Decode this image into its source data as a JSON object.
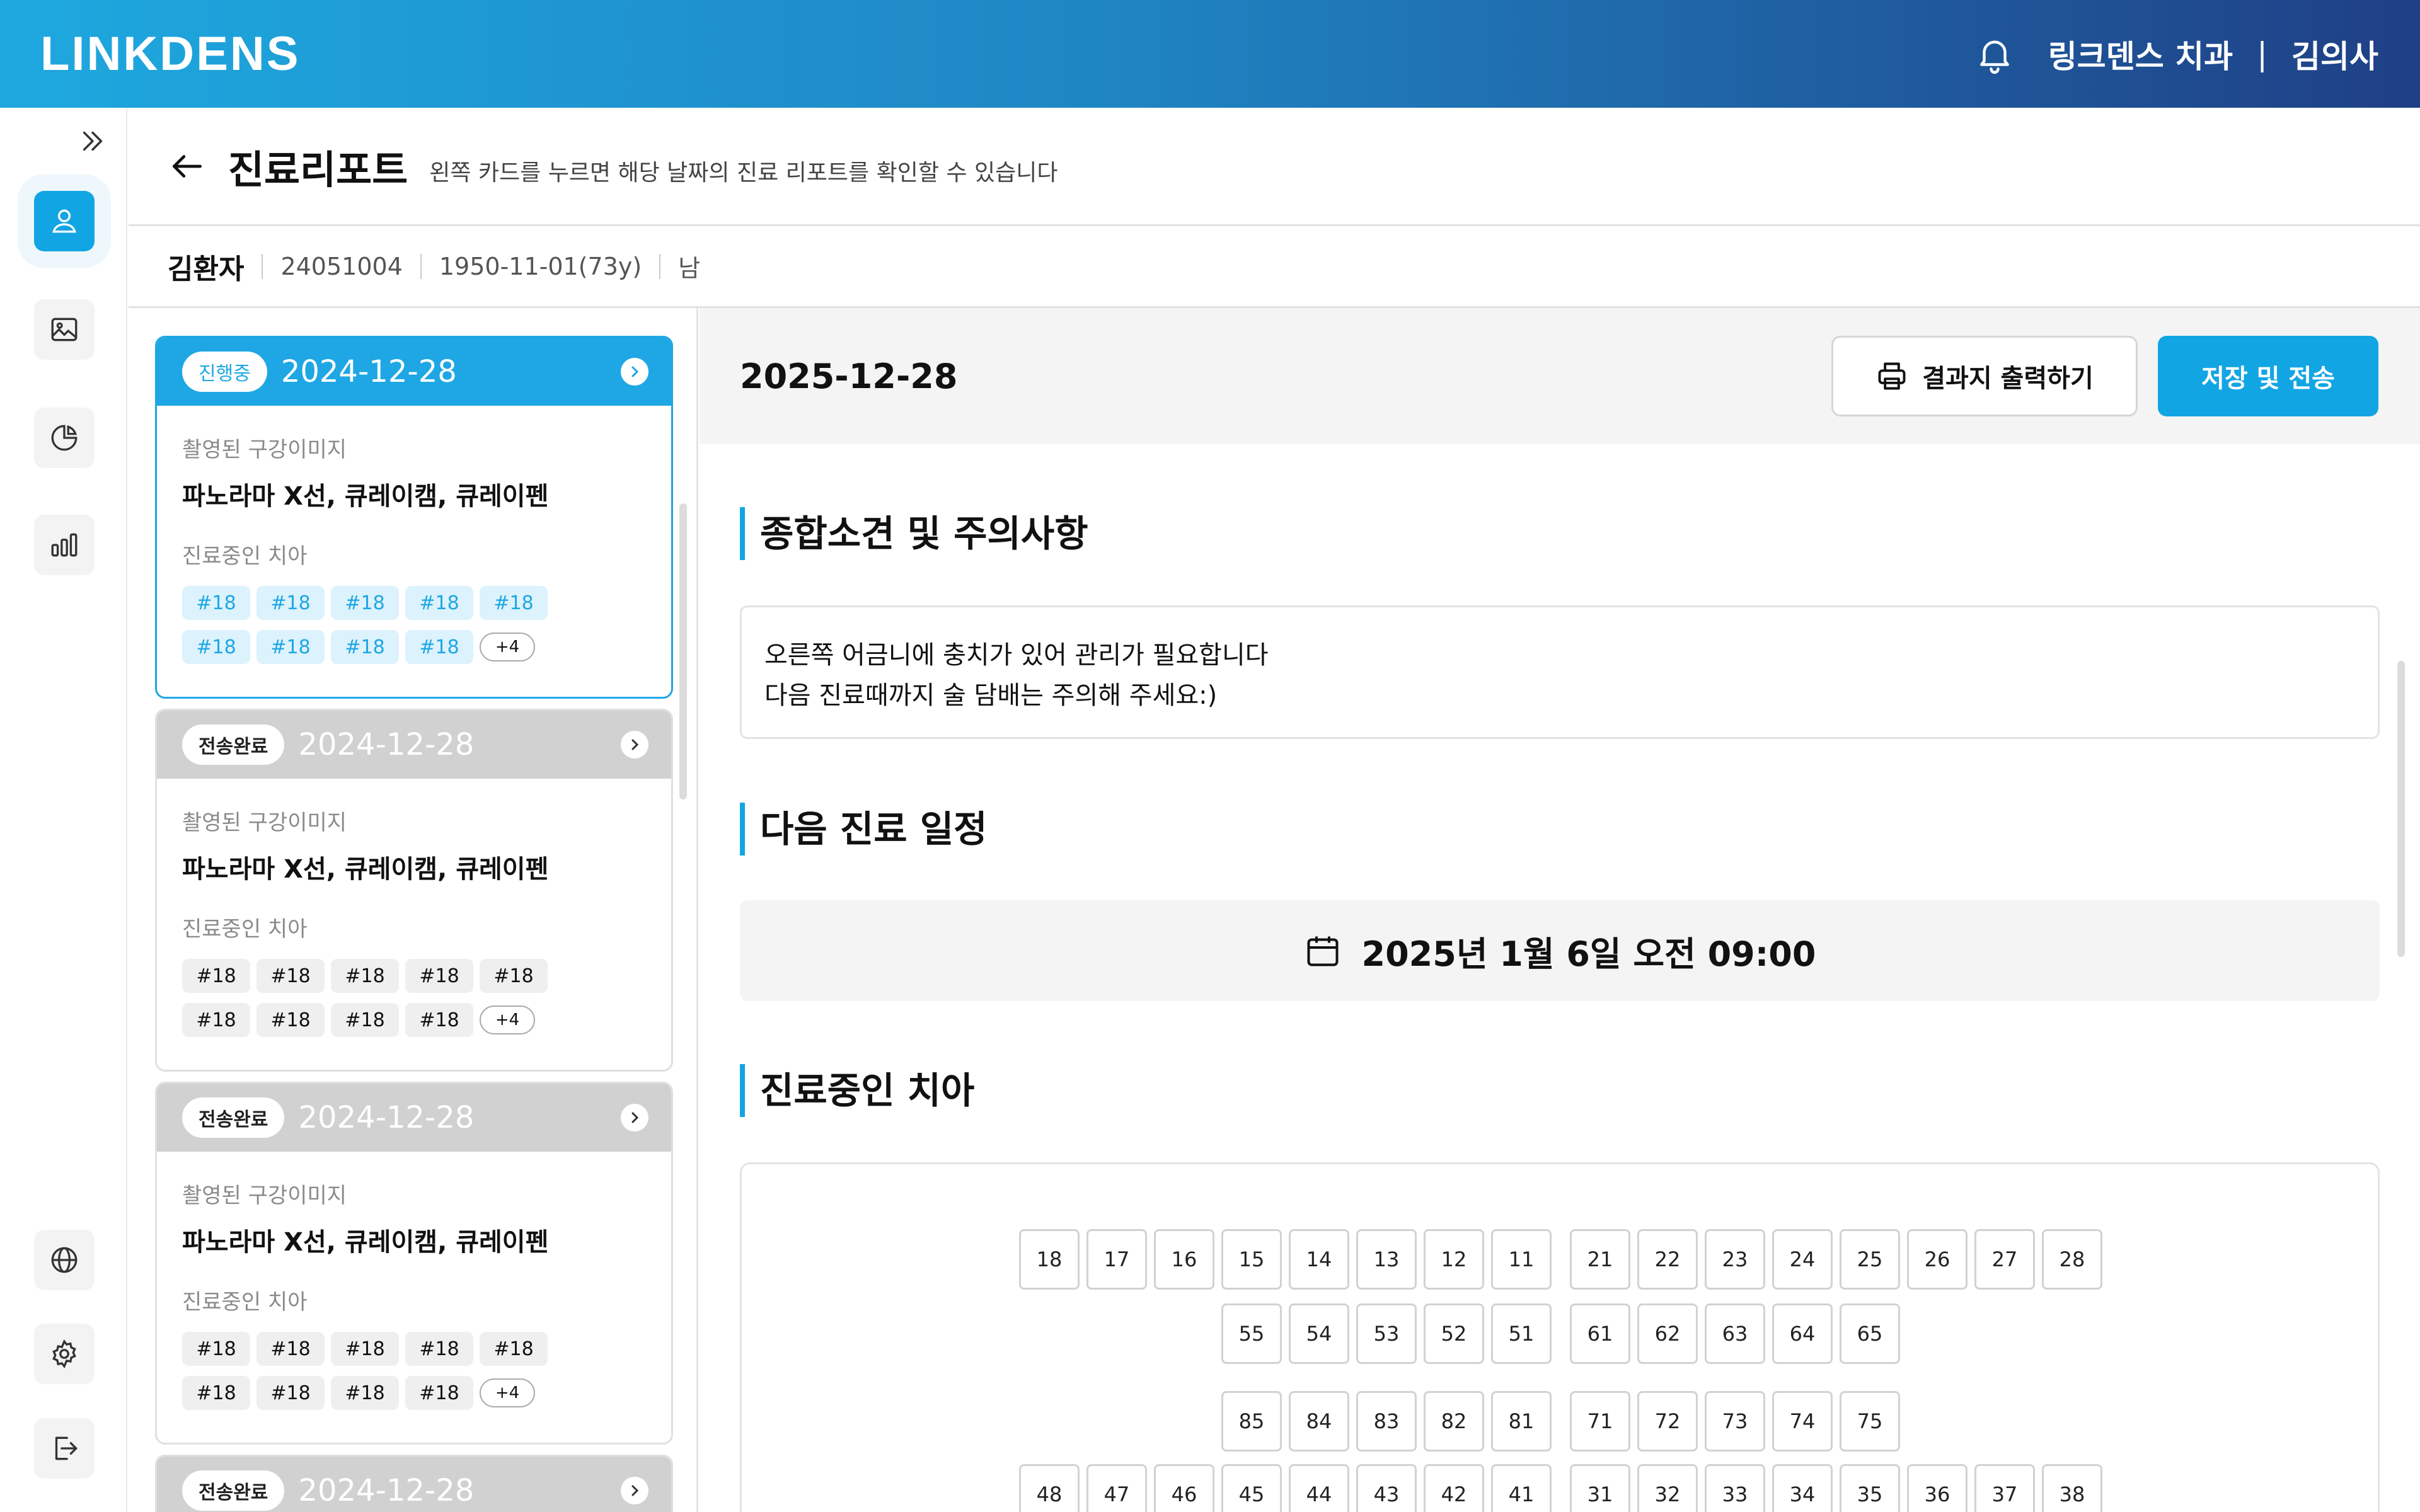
{
  "app": {
    "logo": "LINKDENS",
    "clinic": "링크덴스 치과",
    "separator": "|",
    "doctor": "김의사"
  },
  "icons": {
    "bell": "bell-icon",
    "expand": "double-chevron-right-icon",
    "person": "person-icon",
    "image": "image-icon",
    "pie": "pie-chart-icon",
    "bars": "bar-chart-icon",
    "globe": "globe-icon",
    "settings": "gear-icon",
    "logout": "logout-icon",
    "back": "arrow-left-icon",
    "printer": "printer-icon",
    "calendar": "calendar-icon"
  },
  "colors": {
    "accent": "#12a5e4",
    "header_start": "#1ea8df",
    "header_end": "#1f3f85"
  },
  "page": {
    "title": "진료리포트",
    "hint": "왼쪽 카드를 누르면 해당 날짜의 진료 리포트를 확인할 수 있습니다"
  },
  "patient": {
    "name": "김환자",
    "id": "24051004",
    "birth": "1950-11-01(73y)",
    "sex": "남"
  },
  "cards": [
    {
      "status": "진행중",
      "date": "2024-12-28",
      "image_label": "촬영된 구강이미지",
      "images": "파노라마 X선, 큐레이캠, 큐레이펜",
      "teeth_label": "진료중인 치아",
      "tags": [
        "#18",
        "#18",
        "#18",
        "#18",
        "#18",
        "#18",
        "#18",
        "#18",
        "#18"
      ],
      "more": "+4"
    },
    {
      "status": "전송완료",
      "date": "2024-12-28",
      "image_label": "촬영된 구강이미지",
      "images": "파노라마 X선, 큐레이캠, 큐레이펜",
      "teeth_label": "진료중인 치아",
      "tags": [
        "#18",
        "#18",
        "#18",
        "#18",
        "#18",
        "#18",
        "#18",
        "#18",
        "#18"
      ],
      "more": "+4"
    },
    {
      "status": "전송완료",
      "date": "2024-12-28",
      "image_label": "촬영된 구강이미지",
      "images": "파노라마 X선, 큐레이캠, 큐레이펜",
      "teeth_label": "진료중인 치아",
      "tags": [
        "#18",
        "#18",
        "#18",
        "#18",
        "#18",
        "#18",
        "#18",
        "#18",
        "#18"
      ],
      "more": "+4"
    },
    {
      "status": "전송완료",
      "date": "2024-12-28"
    }
  ],
  "report": {
    "date": "2025-12-28",
    "print_label": "결과지 출력하기",
    "save_label": "저장 및 전송",
    "sections": {
      "notes_title": "종합소견 및 주의사항",
      "notes_line1": "오른쪽 어금니에 충치가 있어 관리가 필요합니다",
      "notes_line2": "다음 진료때까지 술 담배는 주의해 주세요:)",
      "schedule_title": "다음 진료 일정",
      "schedule_value": "2025년 1월 6일 오전 09:00",
      "teeth_title": "진료중인 치아"
    }
  },
  "teeth": {
    "upper_permanent_right": [
      "18",
      "17",
      "16",
      "15",
      "14",
      "13",
      "12",
      "11"
    ],
    "upper_permanent_left": [
      "21",
      "22",
      "23",
      "24",
      "25",
      "26",
      "27",
      "28"
    ],
    "upper_primary_right": [
      "55",
      "54",
      "53",
      "52",
      "51"
    ],
    "upper_primary_left": [
      "61",
      "62",
      "63",
      "64",
      "65"
    ],
    "lower_primary_right": [
      "85",
      "84",
      "83",
      "82",
      "81"
    ],
    "lower_primary_left": [
      "71",
      "72",
      "73",
      "74",
      "75"
    ],
    "lower_permanent_right": [
      "48",
      "47",
      "46",
      "45",
      "44",
      "43",
      "42",
      "41"
    ],
    "lower_permanent_left": [
      "31",
      "32",
      "33",
      "34",
      "35",
      "36",
      "37",
      "38"
    ]
  }
}
